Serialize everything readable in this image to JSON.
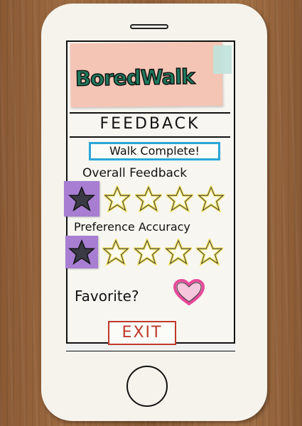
{
  "app": {
    "logo_text": "BoredWalk"
  },
  "page": {
    "title": "FEEDBACK",
    "status_badge": "Walk Complete!"
  },
  "overall_feedback": {
    "label": "Overall Feedback",
    "rating": 1,
    "max": 5
  },
  "preference_accuracy": {
    "label": "Preference Accuracy",
    "rating": 1,
    "max": 5
  },
  "favorite": {
    "label": "Favorite?",
    "icon": "heart-icon",
    "selected": false
  },
  "exit": {
    "label": "EXIT"
  },
  "colors": {
    "logo_green": "#1e7a5d",
    "sticky_pink": "#f4c5b5",
    "badge_blue": "#2aa6d8",
    "selected_purple": "#a77ed1",
    "star_yellow": "#f2e36a",
    "heart_pink": "#e64a9a",
    "exit_red": "#c0392b"
  }
}
